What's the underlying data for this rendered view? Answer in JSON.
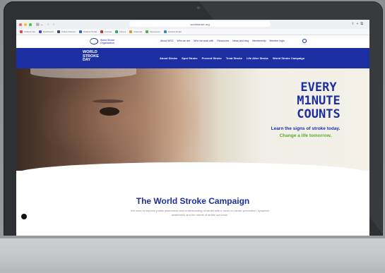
{
  "browser": {
    "url": "worldstroke.org",
    "bookmarks": [
      "Student Life",
      "Dashboard",
      "Online Classes",
      "Student Portal",
      "Canvas",
      "Library",
      "Calendar",
      "Resources",
      "Student Email"
    ]
  },
  "site": {
    "logo_text": "World Stroke Organization",
    "top_links": [
      "About WSO",
      "Who we are",
      "Who we work with",
      "Resources",
      "News and blog",
      "Membership",
      "Member login"
    ],
    "brand_lines": [
      "WORLD",
      "STROKE",
      "DAY"
    ],
    "main_nav": [
      "About Stroke",
      "Spot Stroke",
      "Prevent Stroke",
      "Treat Stroke",
      "Life After Stroke",
      "World Stroke Campaign"
    ]
  },
  "hero": {
    "headline_lines": [
      "EVERY",
      "M1NUTE",
      "COUNTS"
    ],
    "sub1": "Learn the signs of stroke today.",
    "sub2": "Change a life tomorrow."
  },
  "section": {
    "title": "The World Stroke Campaign",
    "intro": "We work to improve public awareness and understanding of stroke with a focus on stroke prevention, symptom awareness and the needs of stroke survivors."
  },
  "colors": {
    "brand_blue": "#1b2fa3",
    "accent_green": "#5aa92f",
    "laptop_frame": "#2f3033"
  }
}
